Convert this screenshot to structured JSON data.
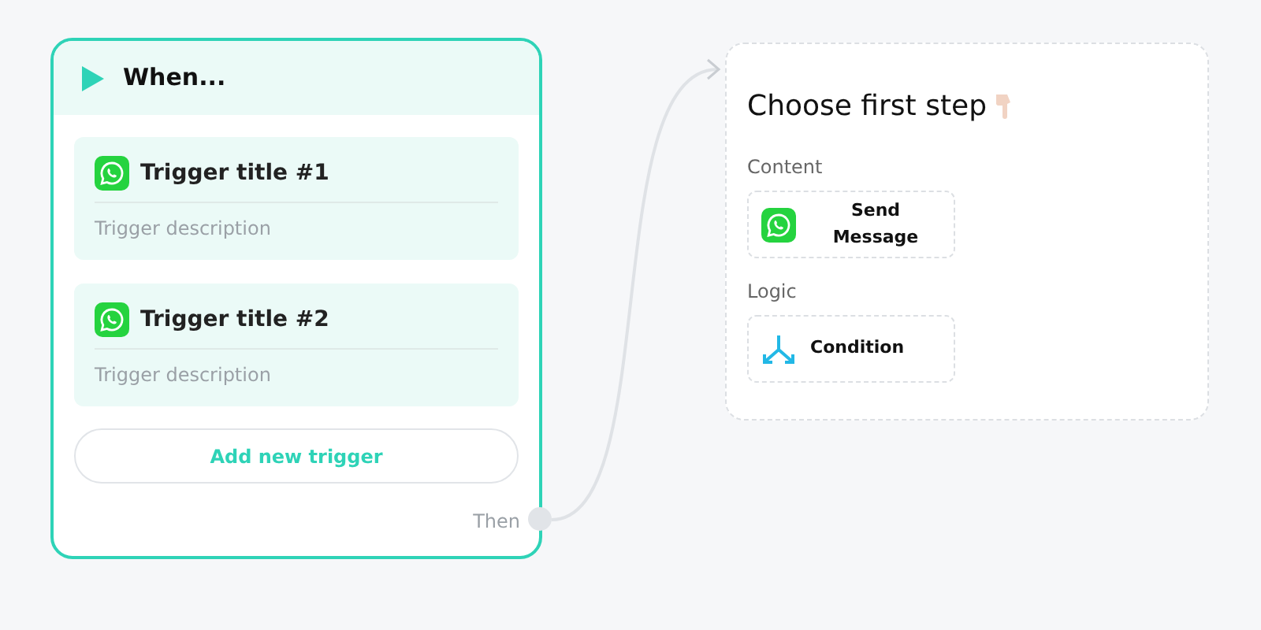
{
  "trigger_node": {
    "title": "When...",
    "triggers": [
      {
        "title": "Trigger title #1",
        "description": "Trigger description"
      },
      {
        "title": "Trigger title #2",
        "description": "Trigger description"
      }
    ],
    "add_button": "Add new trigger",
    "output_label": "Then"
  },
  "step_picker": {
    "title": "Choose first step",
    "groups": [
      {
        "label": "Content",
        "options": [
          {
            "kind": "message",
            "label": "Send Message"
          }
        ]
      },
      {
        "label": "Logic",
        "options": [
          {
            "kind": "condition",
            "label": "Condition"
          }
        ]
      }
    ]
  }
}
